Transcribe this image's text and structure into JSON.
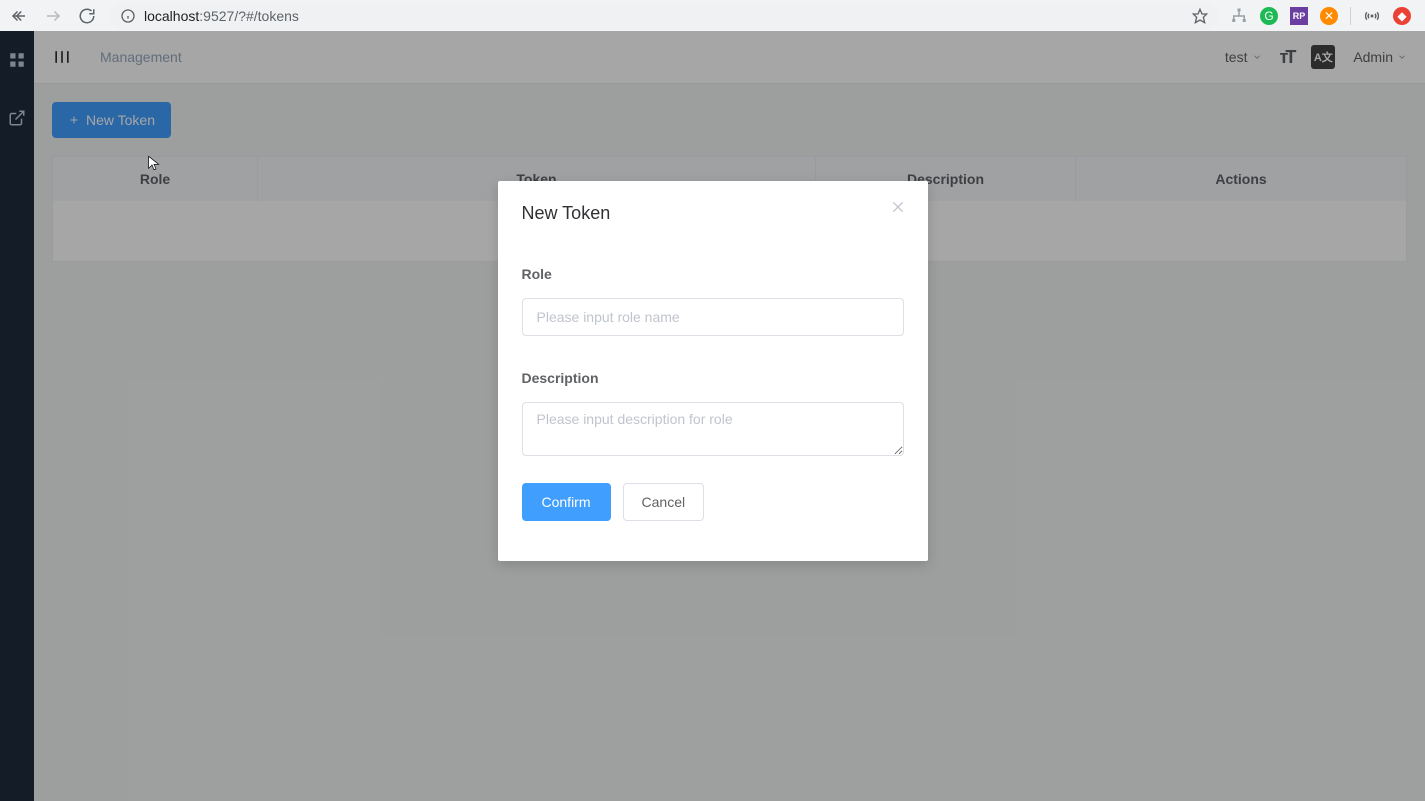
{
  "browser": {
    "url_host": "localhost",
    "url_port": ":9527",
    "url_path": "/?#/tokens"
  },
  "topbar": {
    "breadcrumb": "Management",
    "project": "test",
    "user": "Admin",
    "lang_badge": "A文"
  },
  "page": {
    "new_token_btn": "New Token",
    "columns": {
      "role": "Role",
      "token": "Token",
      "description": "Description",
      "actions": "Actions"
    }
  },
  "modal": {
    "title": "New Token",
    "role_label": "Role",
    "role_placeholder": "Please input role name",
    "desc_label": "Description",
    "desc_placeholder": "Please input description for role",
    "confirm": "Confirm",
    "cancel": "Cancel"
  }
}
